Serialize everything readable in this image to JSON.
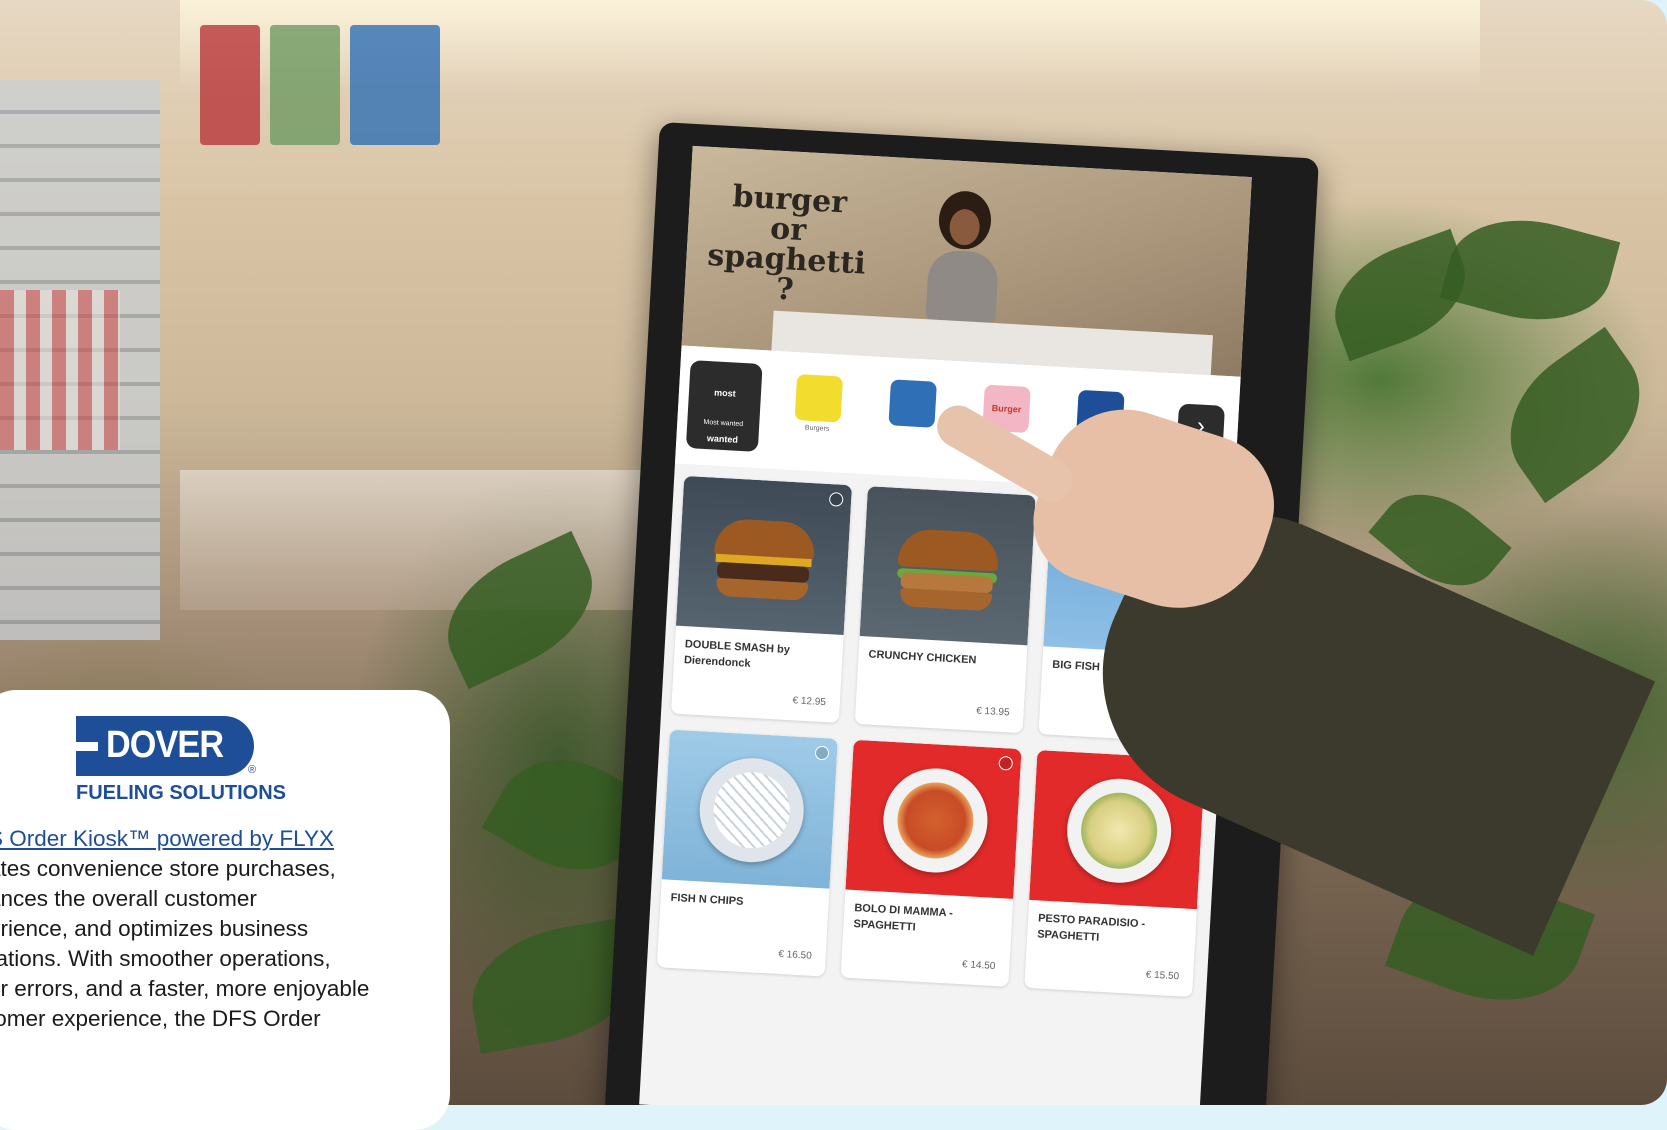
{
  "kiosk": {
    "hero_text": "burger or spaghetti ?",
    "categories": [
      {
        "icon_text": "most wanted",
        "label": "Most wanted",
        "active": true
      },
      {
        "icon_text": "",
        "label": "Burgers",
        "active": false
      },
      {
        "icon_text": "",
        "label": "",
        "active": false
      },
      {
        "icon_text": "Burger",
        "label": "",
        "active": false
      },
      {
        "icon_text": "",
        "label": "",
        "active": false
      }
    ],
    "next_icon": "chevron-right-icon",
    "products": [
      {
        "name": "DOUBLE SMASH by Dierendonck",
        "price": "€ 12.95"
      },
      {
        "name": "CRUNCHY CHICKEN",
        "price": "€ 13.95"
      },
      {
        "name": "BIG FISH BURGER",
        "price": ""
      },
      {
        "name": "FISH N CHIPS",
        "price": "€ 16.50"
      },
      {
        "name": "BOLO DI MAMMA - SPAGHETTI",
        "price": "€ 14.50"
      },
      {
        "name": "PESTO PARADISIO - SPAGHETTI",
        "price": "€ 15.50"
      }
    ]
  },
  "overlay": {
    "logo_word": "DOVER",
    "logo_reg": "®",
    "logo_sub": "FUELING SOLUTIONS",
    "link_text": "S Order Kiosk™ powered by FLYX",
    "lines": [
      "ates convenience store purchases,",
      "ances the overall customer",
      "erience, and optimizes business",
      "rations. With smoother operations,",
      "er errors, and a faster, more enjoyable",
      "tomer experience, the DFS Order"
    ]
  },
  "colors": {
    "brand_blue": "#1f4e98",
    "background_tint": "#dff3fb"
  }
}
